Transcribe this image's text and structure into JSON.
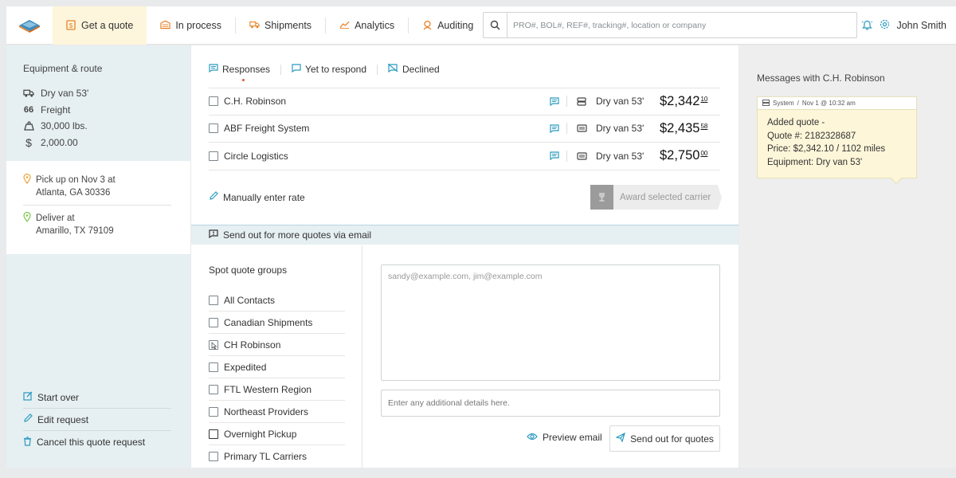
{
  "nav": {
    "items": [
      {
        "label": "Get a quote",
        "icon": "quote-icon"
      },
      {
        "label": "In process",
        "icon": "warehouse-icon"
      },
      {
        "label": "Shipments",
        "icon": "truck-icon"
      },
      {
        "label": "Analytics",
        "icon": "chart-icon"
      },
      {
        "label": "Auditing",
        "icon": "audit-icon"
      }
    ],
    "active": 0,
    "search_placeholder": "PRO#, BOL#, REF#, tracking#, location or company",
    "user_name": "John Smith",
    "accent_color": "#e8832a"
  },
  "left": {
    "title": "Equipment & route",
    "equipment": [
      {
        "icon": "truck-icon",
        "text": "Dry van 53'"
      },
      {
        "icon": "66",
        "text": "Freight"
      },
      {
        "icon": "weight-icon",
        "text": "30,000 lbs."
      },
      {
        "icon": "$",
        "text": "2,000.00"
      }
    ],
    "pickup": {
      "line1": "Pick up on Nov 3 at",
      "line2": "Atlanta, GA 30336"
    },
    "deliver": {
      "line1": "Deliver at",
      "line2": "Amarillo, TX 79109"
    },
    "actions": [
      "Start over",
      "Edit request",
      "Cancel this quote request"
    ]
  },
  "tabs": [
    "Responses",
    "Yet to respond",
    "Declined"
  ],
  "carriers": [
    {
      "name": "C.H. Robinson",
      "equipment": "Dry van 53'",
      "price": "$2,342",
      "cents": "10"
    },
    {
      "name": "ABF Freight System",
      "equipment": "Dry van 53'",
      "price": "$2,435",
      "cents": "58"
    },
    {
      "name": "Circle Logistics",
      "equipment": "Dry van 53'",
      "price": "$2,750",
      "cents": "00"
    }
  ],
  "manual_rate": "Manually enter rate",
  "award_label": "Award selected carrier",
  "email_bar": "Send out for more quotes via email",
  "spot": {
    "title": "Spot quote groups",
    "groups": [
      "All Contacts",
      "Canadian Shipments",
      "CH Robinson",
      "Expedited",
      "FTL Western Region",
      "Northeast Providers",
      "Overnight Pickup",
      "Primary TL Carriers"
    ]
  },
  "compose": {
    "emails_placeholder": "sandy@example.com, jim@example.com",
    "details_placeholder": "Enter any additional details here.",
    "preview": "Preview email",
    "send": "Send out for quotes"
  },
  "messages": {
    "title": "Messages with C.H. Robinson",
    "note_sender": "System",
    "note_time": "Nov 1 @ 10:32 am",
    "lines": [
      "Added quote -",
      "Quote #: 2182328687",
      "Price: $2,342.10 / 1102 miles",
      "Equipment: Dry van 53'"
    ]
  }
}
